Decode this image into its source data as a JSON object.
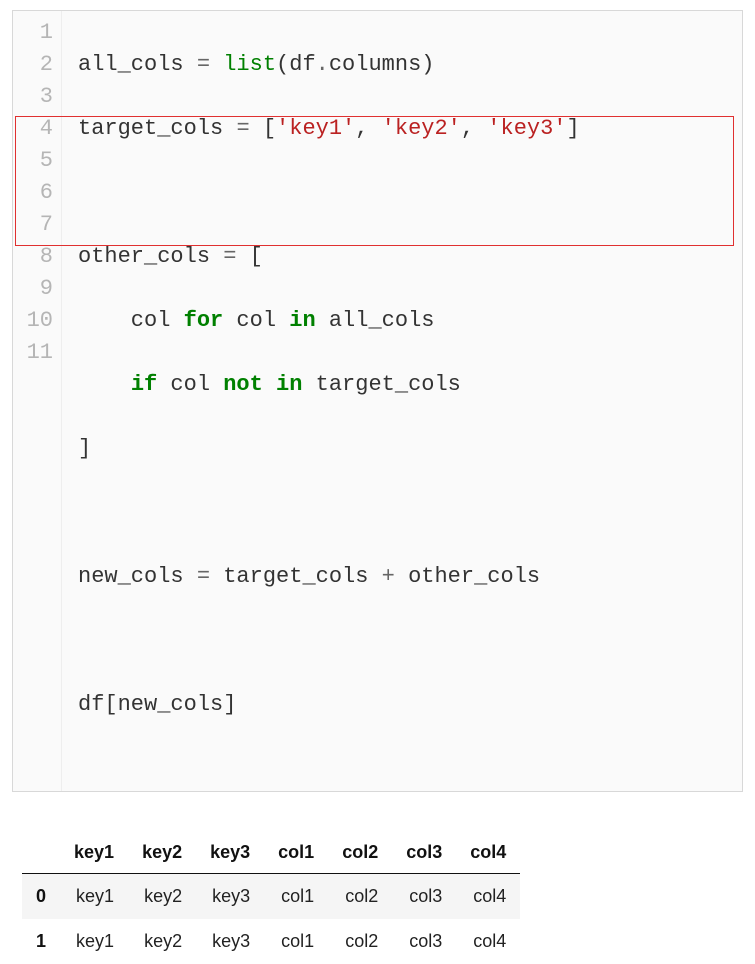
{
  "code": {
    "line_numbers": [
      "1",
      "2",
      "3",
      "4",
      "5",
      "6",
      "7",
      "8",
      "9",
      "10",
      "11"
    ],
    "l1": {
      "a": "all_cols ",
      "eq": "=",
      "sp": " ",
      "list": "list",
      "open": "(df",
      "dot": ".",
      "cols": "columns)",
      "end": ""
    },
    "l2": {
      "a": "target_cols ",
      "eq": "=",
      "b": " [",
      "s1": "'key1'",
      "c1": ", ",
      "s2": "'key2'",
      "c2": ", ",
      "s3": "'key3'",
      "end": "]"
    },
    "l3": {
      "text": ""
    },
    "l4": {
      "a": "other_cols ",
      "eq": "=",
      "b": " ["
    },
    "l5": {
      "pad": "    col ",
      "for": "for",
      "mid": " col ",
      "in": "in",
      "tail": " all_cols"
    },
    "l6": {
      "pad": "    ",
      "if": "if",
      "mid": " col ",
      "not": "not",
      "sp": " ",
      "in": "in",
      "tail": " target_cols"
    },
    "l7": {
      "text": "]"
    },
    "l8": {
      "text": ""
    },
    "l9": {
      "a": "new_cols ",
      "eq": "=",
      "b": " target_cols ",
      "plus": "+",
      "c": " other_cols"
    },
    "l10": {
      "text": ""
    },
    "l11": {
      "text": "df[new_cols]"
    }
  },
  "table": {
    "columns": [
      "key1",
      "key2",
      "key3",
      "col1",
      "col2",
      "col3",
      "col4"
    ],
    "rows": [
      {
        "idx": "0",
        "cells": [
          "key1",
          "key2",
          "key3",
          "col1",
          "col2",
          "col3",
          "col4"
        ]
      },
      {
        "idx": "1",
        "cells": [
          "key1",
          "key2",
          "key3",
          "col1",
          "col2",
          "col3",
          "col4"
        ]
      }
    ]
  }
}
